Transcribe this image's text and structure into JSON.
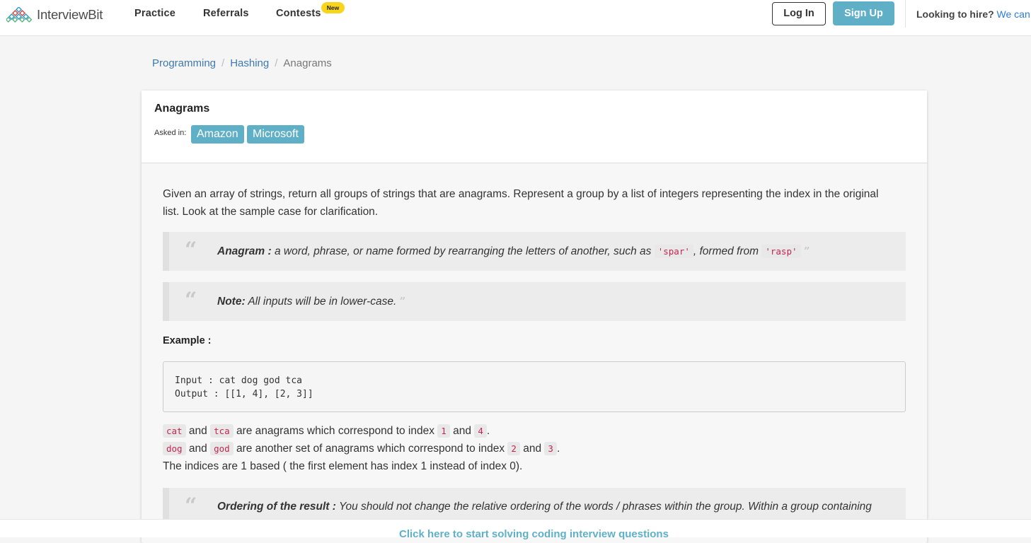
{
  "header": {
    "logo_text": "InterviewBit",
    "nav": {
      "practice": "Practice",
      "referrals": "Referrals",
      "contests": "Contests",
      "contests_badge": "New"
    },
    "login_label": "Log In",
    "signup_label": "Sign Up",
    "hire_text": "Looking to hire?",
    "hire_link": "We can help"
  },
  "breadcrumb": {
    "items": [
      "Programming",
      "Hashing",
      "Anagrams"
    ]
  },
  "problem": {
    "title": "Anagrams",
    "asked_in_label": "Asked in:",
    "companies": [
      "Amazon",
      "Microsoft"
    ],
    "description_line1": "Given an array of strings, return all groups of strings that are anagrams. Represent a group by a list of integers representing the index in the original",
    "description_line2": "list. Look at the sample case for clarification.",
    "quote1": {
      "label": "Anagram :",
      "text_before": " a word, phrase, or name formed by rearranging the letters of another, such as ",
      "code1": "'spar'",
      "text_mid": ", formed from ",
      "code2": "'rasp'"
    },
    "quote2": {
      "label": "Note:",
      "text": " All inputs will be in lower-case."
    },
    "example_label": "Example :",
    "code_block": "Input : cat dog god tca\nOutput : [[1, 4], [2, 3]]",
    "explain1": {
      "c1": "cat",
      "t1": "and",
      "c2": "tca",
      "t2": "are anagrams which correspond to index",
      "c3": "1",
      "t3": "and",
      "c4": "4",
      "t4": "."
    },
    "explain2": {
      "c1": "dog",
      "t1": "and",
      "c2": "god",
      "t2": "are another set of anagrams which correspond to index",
      "c3": "2",
      "t3": "and",
      "c4": "3",
      "t4": "."
    },
    "explain3": "The indices are 1 based ( the first element has index 1 instead of index 0).",
    "quote3": {
      "label": "Ordering of the result :",
      "text": " You should not change the relative ordering of the words / phrases within the group. Within a group containing"
    }
  },
  "bottom_cta": "Click here to start solving coding interview questions",
  "colors": {
    "accent": "#5fb0c7",
    "link": "#3d79b1",
    "code_text": "#c7254e",
    "badge": "#f8d51a"
  }
}
